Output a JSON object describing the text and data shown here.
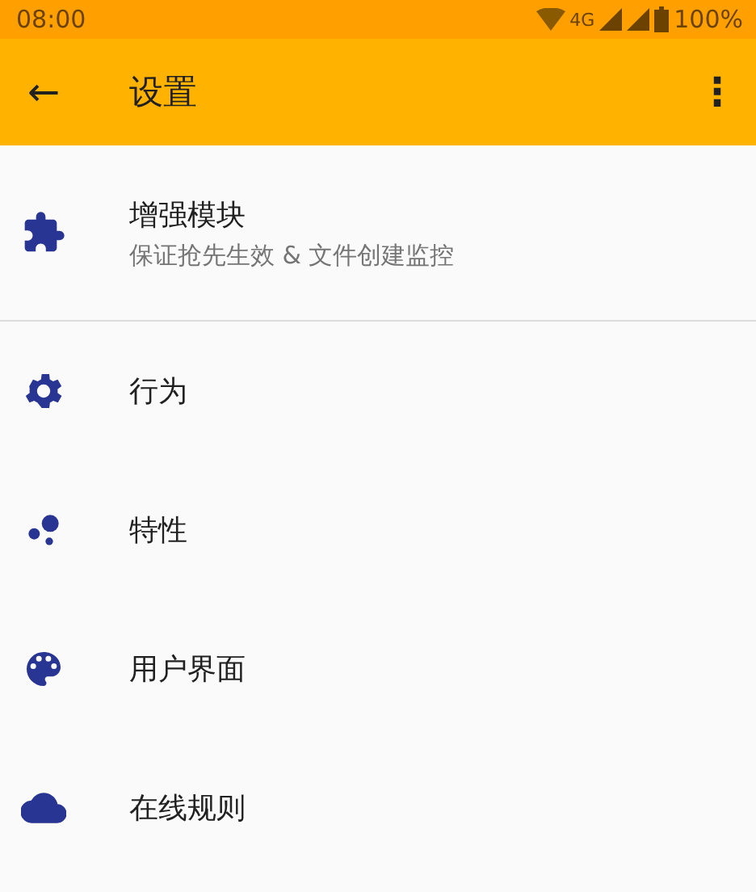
{
  "status_bar": {
    "time": "08:00",
    "network": "4G",
    "battery": "100%"
  },
  "toolbar": {
    "back": "←",
    "title": "设置",
    "menu": "⋮"
  },
  "sections": [
    {
      "items": [
        {
          "kind": "puzzle",
          "title": "增强模块",
          "subtitle": "保证抢先生效 & 文件创建监控"
        }
      ]
    },
    {
      "items": [
        {
          "kind": "gear",
          "title": "行为"
        },
        {
          "kind": "bubbles",
          "title": "特性"
        },
        {
          "kind": "palette",
          "title": "用户界面"
        },
        {
          "kind": "cloud",
          "title": "在线规则"
        }
      ]
    }
  ]
}
